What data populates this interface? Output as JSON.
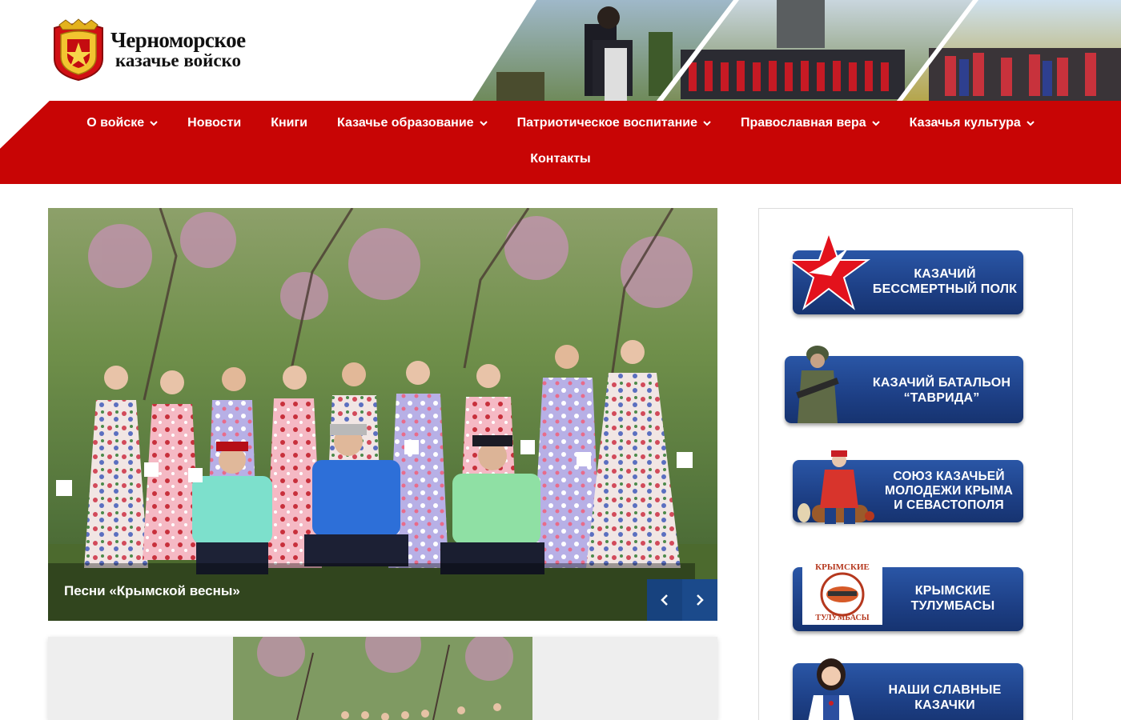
{
  "site": {
    "logo_line1": "Черноморское",
    "logo_line2": "казачье войско"
  },
  "nav": {
    "items": [
      {
        "label": "О войске",
        "dropdown": true
      },
      {
        "label": "Новости",
        "dropdown": false
      },
      {
        "label": "Книги",
        "dropdown": false
      },
      {
        "label": "Казачье образование",
        "dropdown": true
      },
      {
        "label": "Патриотическое воспитание",
        "dropdown": true
      },
      {
        "label": "Православная вера",
        "dropdown": true
      },
      {
        "label": "Казачья культура",
        "dropdown": true
      },
      {
        "label": "Контакты",
        "dropdown": false
      }
    ]
  },
  "slider": {
    "caption": "Песни «Крымской весны»",
    "prev_icon": "chevron-left-icon",
    "next_icon": "chevron-right-icon"
  },
  "sidebar": {
    "banners": [
      {
        "line1": "КАЗАЧИЙ",
        "line2": "БЕССМЕРТНЫЙ ПОЛК",
        "line3": ""
      },
      {
        "line1": "КАЗАЧИЙ БАТАЛЬОН",
        "line2": "“ТАВРИДА”",
        "line3": ""
      },
      {
        "line1": "СОЮЗ КАЗАЧЬЕЙ",
        "line2": "МОЛОДЕЖИ КРЫМА",
        "line3": "И СЕВАСТОПОЛЯ"
      },
      {
        "line1": "КРЫМСКИЕ",
        "line2": "ТУЛУМБАСЫ",
        "line3": "",
        "badge_top": "КРЫМСКИЕ",
        "badge_bottom": "ТУЛУМБАСЫ"
      },
      {
        "line1": "НАШИ СЛАВНЫЕ",
        "line2": "КАЗАЧКИ",
        "line3": ""
      }
    ]
  },
  "colors": {
    "nav_red": "#c80505",
    "button_blue": "#17427e",
    "banner_blue": "#1d3f85"
  }
}
